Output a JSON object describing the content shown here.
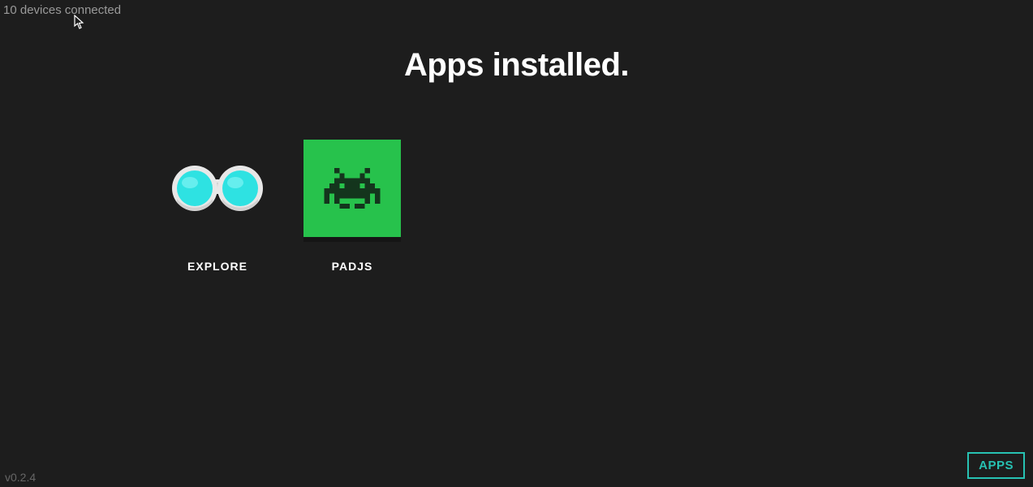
{
  "status": "10 devices connected",
  "title": "Apps installed.",
  "apps": {
    "explore": {
      "label": "EXPLORE"
    },
    "padjs": {
      "label": "PADJS"
    }
  },
  "version": "v0.2.4",
  "appsButton": "APPS"
}
